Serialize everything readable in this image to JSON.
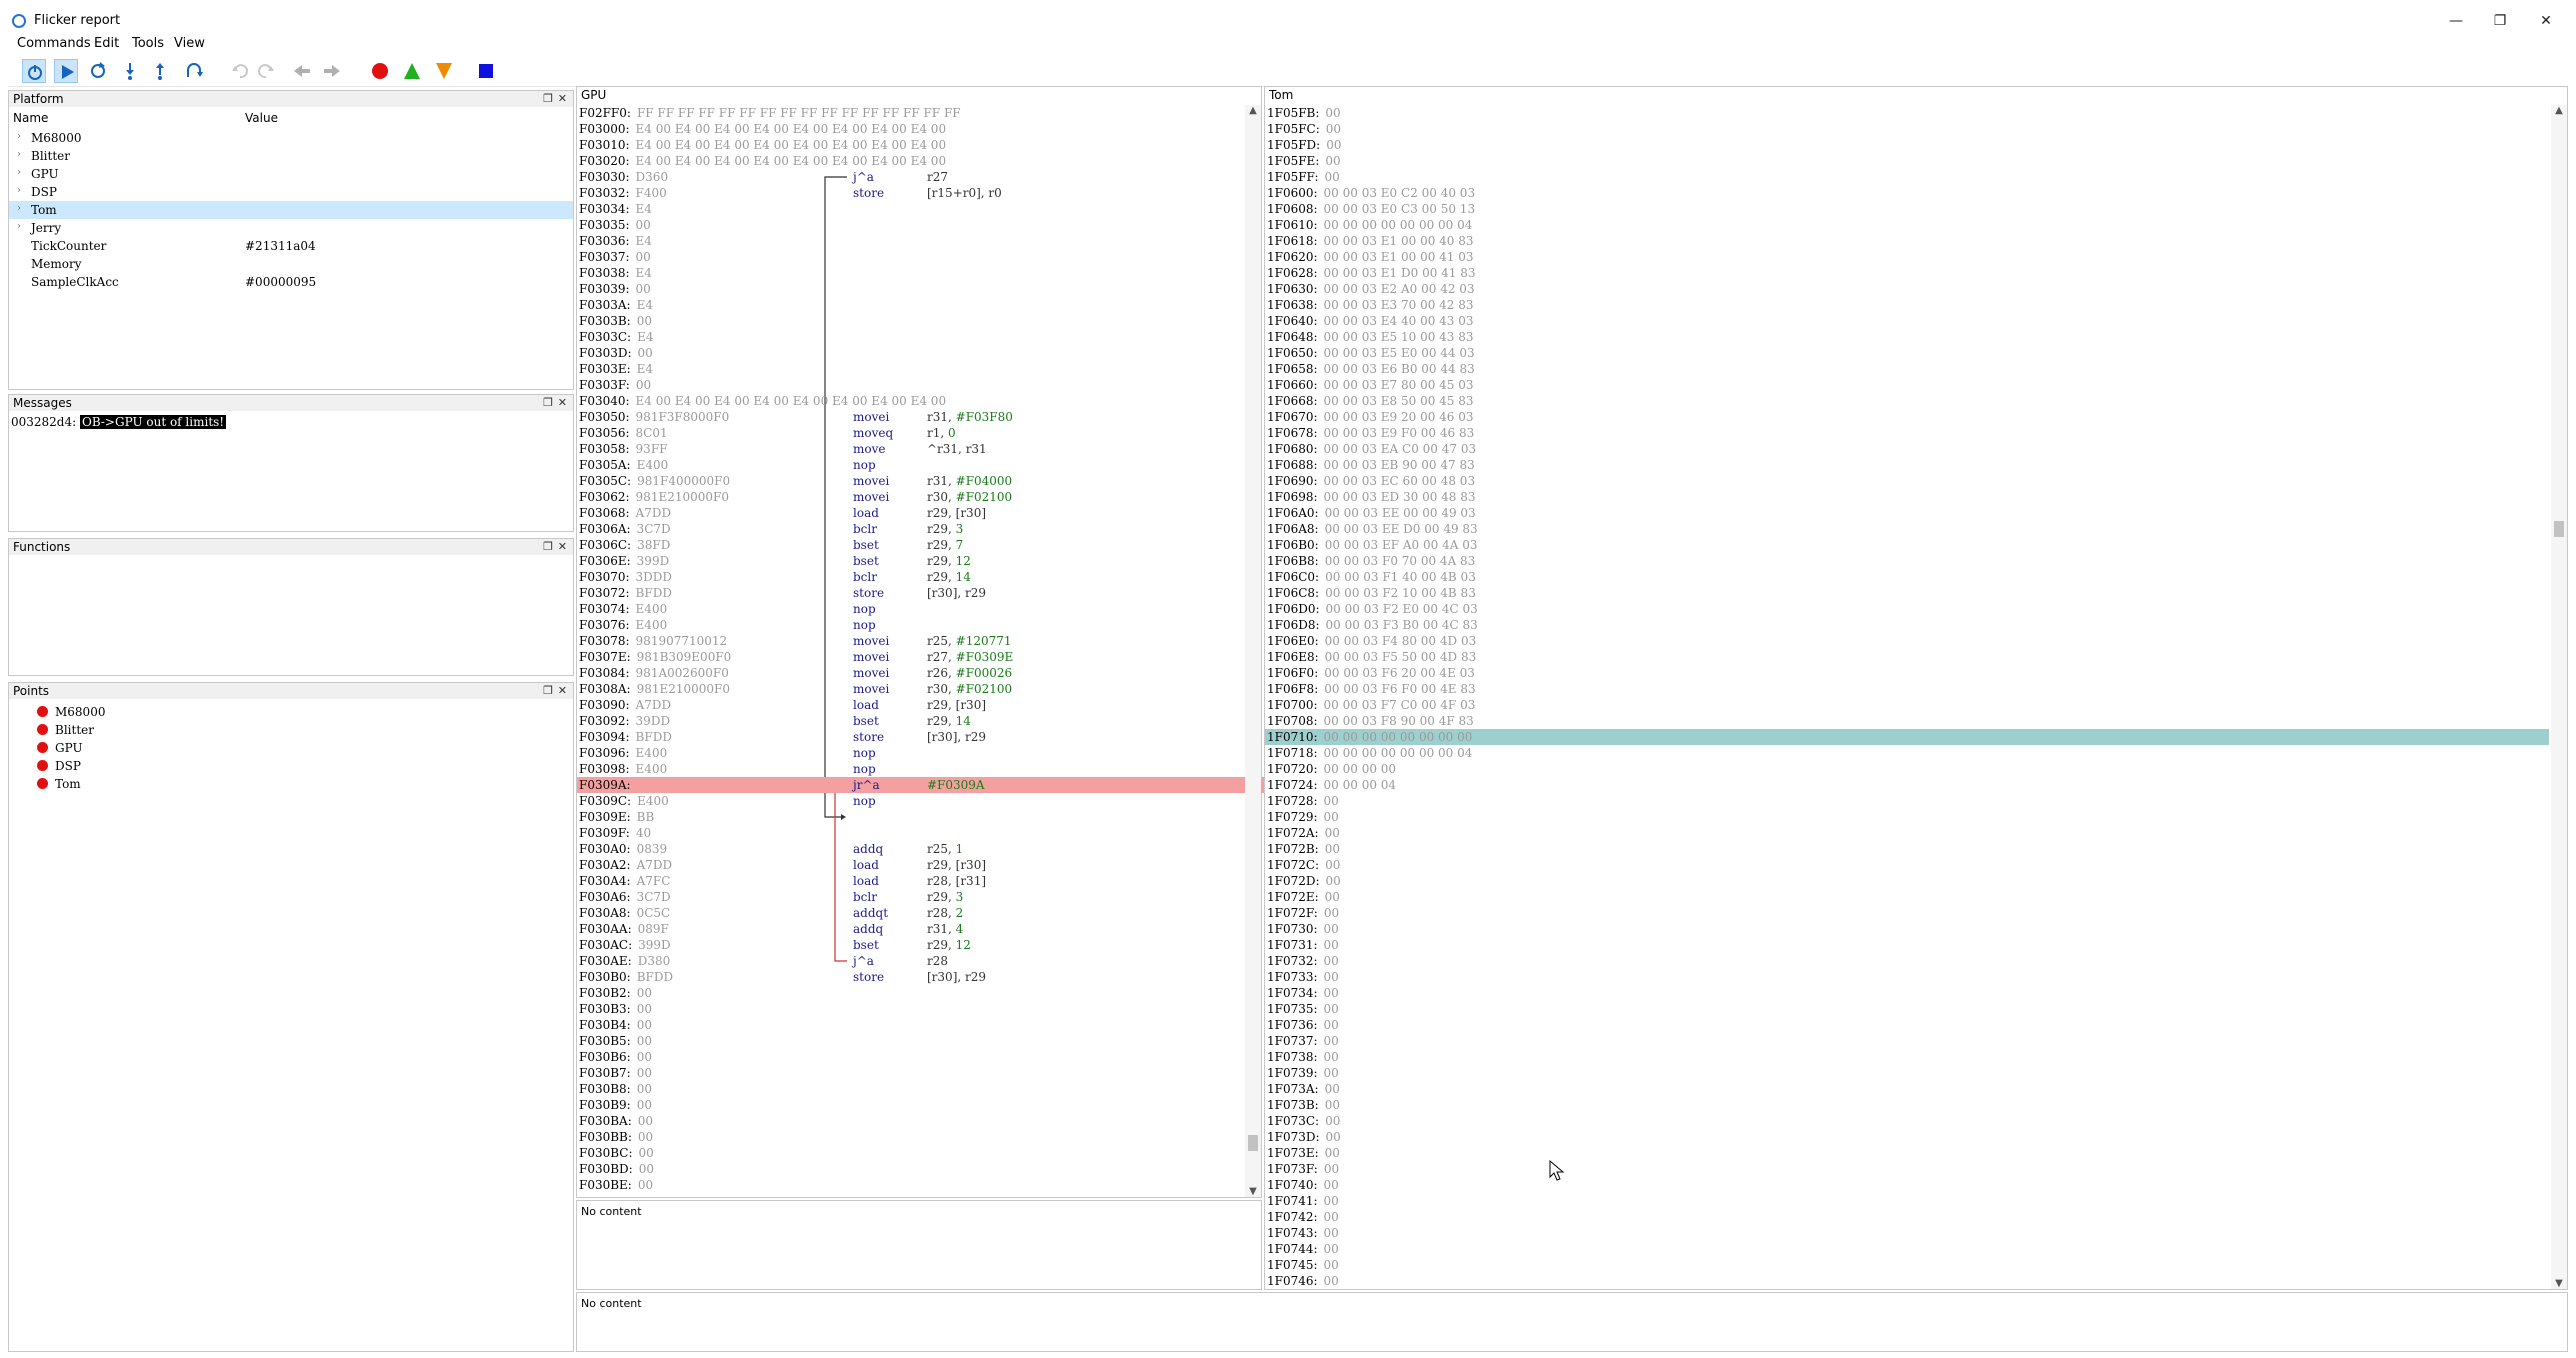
{
  "window": {
    "title": "Flicker report",
    "min": "—",
    "restore": "❐",
    "close": "✕"
  },
  "menu": [
    "Commands",
    "Edit",
    "Tools",
    "View"
  ],
  "panels": {
    "platform": {
      "title": "Platform",
      "col_name": "Name",
      "col_value": "Value",
      "rows": [
        {
          "name": "M68000",
          "value": "",
          "expander": true
        },
        {
          "name": "Blitter",
          "value": "",
          "expander": true
        },
        {
          "name": "GPU",
          "value": "",
          "expander": true
        },
        {
          "name": "DSP",
          "value": "",
          "expander": true
        },
        {
          "name": "Tom",
          "value": "",
          "expander": true,
          "selected": true
        },
        {
          "name": "Jerry",
          "value": "",
          "expander": true
        },
        {
          "name": "TickCounter",
          "value": "#21311a04",
          "expander": false
        },
        {
          "name": "Memory",
          "value": "",
          "expander": false
        },
        {
          "name": "SampleClkAcc",
          "value": "#00000095",
          "expander": false
        }
      ]
    },
    "messages": {
      "title": "Messages",
      "prefix": "003282d4:",
      "text": "OB->GPU out of limits!"
    },
    "functions": {
      "title": "Functions"
    },
    "points": {
      "title": "Points",
      "items": [
        "M68000",
        "Blitter",
        "GPU",
        "DSP",
        "Tom"
      ]
    },
    "gpu": {
      "title": "GPU",
      "status": "No content",
      "lines": [
        {
          "a": "F02FF0:",
          "b": "FF FF FF FF FF FF FF FF FF FF FF FF FF FF FF FF"
        },
        {
          "a": "F03000:",
          "b": "E4 00 E4 00 E4 00 E4 00 E4 00 E4 00 E4 00 E4 00"
        },
        {
          "a": "F03010:",
          "b": "E4 00 E4 00 E4 00 E4 00 E4 00 E4 00 E4 00 E4 00"
        },
        {
          "a": "F03020:",
          "b": "E4 00 E4 00 E4 00 E4 00 E4 00 E4 00 E4 00 E4 00"
        },
        {
          "a": "F03030:",
          "b": "D360",
          "m": "j^a",
          "o": "r27"
        },
        {
          "a": "F03032:",
          "b": "F400",
          "m": "store",
          "o": "[r15+r0], r0"
        },
        {
          "a": "F03034:",
          "b": "E4"
        },
        {
          "a": "F03035:",
          "b": "00"
        },
        {
          "a": "F03036:",
          "b": "E4"
        },
        {
          "a": "F03037:",
          "b": "00"
        },
        {
          "a": "F03038:",
          "b": "E4"
        },
        {
          "a": "F03039:",
          "b": "00"
        },
        {
          "a": "F0303A:",
          "b": "E4"
        },
        {
          "a": "F0303B:",
          "b": "00"
        },
        {
          "a": "F0303C:",
          "b": "E4"
        },
        {
          "a": "F0303D:",
          "b": "00"
        },
        {
          "a": "F0303E:",
          "b": "E4"
        },
        {
          "a": "F0303F:",
          "b": "00"
        },
        {
          "a": "F03040:",
          "b": "E4 00 E4 00 E4 00 E4 00 E4 00 E4 00 E4 00 E4 00"
        },
        {
          "a": "F03050:",
          "b": "981F3F8000F0",
          "m": "movei",
          "o": "r31, ",
          "i": "#F03F80"
        },
        {
          "a": "F03056:",
          "b": "8C01",
          "m": "moveq",
          "o": "r1, ",
          "i": "0"
        },
        {
          "a": "F03058:",
          "b": "93FF",
          "m": "move",
          "o": "^r31, r31"
        },
        {
          "a": "F0305A:",
          "b": "E400",
          "m": "nop"
        },
        {
          "a": "F0305C:",
          "b": "981F400000F0",
          "m": "movei",
          "o": "r31, ",
          "i": "#F04000"
        },
        {
          "a": "F03062:",
          "b": "981E210000F0",
          "m": "movei",
          "o": "r30, ",
          "i": "#F02100"
        },
        {
          "a": "F03068:",
          "b": "A7DD",
          "m": "load",
          "o": "r29, [r30]"
        },
        {
          "a": "F0306A:",
          "b": "3C7D",
          "m": "bclr",
          "o": "r29, ",
          "i": "3"
        },
        {
          "a": "F0306C:",
          "b": "38FD",
          "m": "bset",
          "o": "r29, ",
          "i": "7"
        },
        {
          "a": "F0306E:",
          "b": "399D",
          "m": "bset",
          "o": "r29, ",
          "i": "12"
        },
        {
          "a": "F03070:",
          "b": "3DDD",
          "m": "bclr",
          "o": "r29, ",
          "i": "14"
        },
        {
          "a": "F03072:",
          "b": "BFDD",
          "m": "store",
          "o": "[r30], r29"
        },
        {
          "a": "F03074:",
          "b": "E400",
          "m": "nop"
        },
        {
          "a": "F03076:",
          "b": "E400",
          "m": "nop"
        },
        {
          "a": "F03078:",
          "b": "981907710012",
          "m": "movei",
          "o": "r25, ",
          "i": "#120771"
        },
        {
          "a": "F0307E:",
          "b": "981B309E00F0",
          "m": "movei",
          "o": "r27, ",
          "i": "#F0309E"
        },
        {
          "a": "F03084:",
          "b": "981A002600F0",
          "m": "movei",
          "o": "r26, ",
          "i": "#F00026"
        },
        {
          "a": "F0308A:",
          "b": "981E210000F0",
          "m": "movei",
          "o": "r30, ",
          "i": "#F02100"
        },
        {
          "a": "F03090:",
          "b": "A7DD",
          "m": "load",
          "o": "r29, [r30]"
        },
        {
          "a": "F03092:",
          "b": "39DD",
          "m": "bset",
          "o": "r29, ",
          "i": "14"
        },
        {
          "a": "F03094:",
          "b": "BFDD",
          "m": "store",
          "o": "[r30], r29"
        },
        {
          "a": "F03096:",
          "b": "E400",
          "m": "nop"
        },
        {
          "a": "F03098:",
          "b": "E400",
          "m": "nop"
        },
        {
          "a": "F0309A:",
          "b": "",
          "m": "jr^a",
          "o": "",
          "i": "#F0309A",
          "hl": true
        },
        {
          "a": "F0309C:",
          "b": "E400",
          "m": "nop"
        },
        {
          "a": "F0309E:",
          "b": "BB"
        },
        {
          "a": "F0309F:",
          "b": "40"
        },
        {
          "a": "F030A0:",
          "b": "0839",
          "m": "addq",
          "o": "r25, ",
          "i": "1"
        },
        {
          "a": "F030A2:",
          "b": "A7DD",
          "m": "load",
          "o": "r29, [r30]"
        },
        {
          "a": "F030A4:",
          "b": "A7FC",
          "m": "load",
          "o": "r28, [r31]"
        },
        {
          "a": "F030A6:",
          "b": "3C7D",
          "m": "bclr",
          "o": "r29, ",
          "i": "3"
        },
        {
          "a": "F030A8:",
          "b": "0C5C",
          "m": "addqt",
          "o": "r28, ",
          "i": "2"
        },
        {
          "a": "F030AA:",
          "b": "089F",
          "m": "addq",
          "o": "r31, ",
          "i": "4"
        },
        {
          "a": "F030AC:",
          "b": "399D",
          "m": "bset",
          "o": "r29, ",
          "i": "12"
        },
        {
          "a": "F030AE:",
          "b": "D380",
          "m": "j^a",
          "o": "r28"
        },
        {
          "a": "F030B0:",
          "b": "BFDD",
          "m": "store",
          "o": "[r30], r29"
        },
        {
          "a": "F030B2:",
          "b": "00"
        },
        {
          "a": "F030B3:",
          "b": "00"
        },
        {
          "a": "F030B4:",
          "b": "00"
        },
        {
          "a": "F030B5:",
          "b": "00"
        },
        {
          "a": "F030B6:",
          "b": "00"
        },
        {
          "a": "F030B7:",
          "b": "00"
        },
        {
          "a": "F030B8:",
          "b": "00"
        },
        {
          "a": "F030B9:",
          "b": "00"
        },
        {
          "a": "F030BA:",
          "b": "00"
        },
        {
          "a": "F030BB:",
          "b": "00"
        },
        {
          "a": "F030BC:",
          "b": "00"
        },
        {
          "a": "F030BD:",
          "b": "00"
        },
        {
          "a": "F030BE:",
          "b": "00"
        }
      ]
    },
    "tom": {
      "title": "Tom",
      "lines": [
        {
          "a": "1F05FB:",
          "b": "00"
        },
        {
          "a": "1F05FC:",
          "b": "00"
        },
        {
          "a": "1F05FD:",
          "b": "00"
        },
        {
          "a": "1F05FE:",
          "b": "00"
        },
        {
          "a": "1F05FF:",
          "b": "00"
        },
        {
          "a": "1F0600:",
          "b": "00 00 03 E0 C2 00 40 03"
        },
        {
          "a": "1F0608:",
          "b": "00 00 03 E0 C3 00 50 13"
        },
        {
          "a": "1F0610:",
          "b": "00 00 00 00 00 00 00 04"
        },
        {
          "a": "1F0618:",
          "b": "00 00 03 E1 00 00 40 83"
        },
        {
          "a": "1F0620:",
          "b": "00 00 03 E1 00 00 41 03"
        },
        {
          "a": "1F0628:",
          "b": "00 00 03 E1 D0 00 41 83"
        },
        {
          "a": "1F0630:",
          "b": "00 00 03 E2 A0 00 42 03"
        },
        {
          "a": "1F0638:",
          "b": "00 00 03 E3 70 00 42 83"
        },
        {
          "a": "1F0640:",
          "b": "00 00 03 E4 40 00 43 03"
        },
        {
          "a": "1F0648:",
          "b": "00 00 03 E5 10 00 43 83"
        },
        {
          "a": "1F0650:",
          "b": "00 00 03 E5 E0 00 44 03"
        },
        {
          "a": "1F0658:",
          "b": "00 00 03 E6 B0 00 44 83"
        },
        {
          "a": "1F0660:",
          "b": "00 00 03 E7 80 00 45 03"
        },
        {
          "a": "1F0668:",
          "b": "00 00 03 E8 50 00 45 83"
        },
        {
          "a": "1F0670:",
          "b": "00 00 03 E9 20 00 46 03"
        },
        {
          "a": "1F0678:",
          "b": "00 00 03 E9 F0 00 46 83"
        },
        {
          "a": "1F0680:",
          "b": "00 00 03 EA C0 00 47 03"
        },
        {
          "a": "1F0688:",
          "b": "00 00 03 EB 90 00 47 83"
        },
        {
          "a": "1F0690:",
          "b": "00 00 03 EC 60 00 48 03"
        },
        {
          "a": "1F0698:",
          "b": "00 00 03 ED 30 00 48 83"
        },
        {
          "a": "1F06A0:",
          "b": "00 00 03 EE 00 00 49 03"
        },
        {
          "a": "1F06A8:",
          "b": "00 00 03 EE D0 00 49 83"
        },
        {
          "a": "1F06B0:",
          "b": "00 00 03 EF A0 00 4A 03"
        },
        {
          "a": "1F06B8:",
          "b": "00 00 03 F0 70 00 4A 83"
        },
        {
          "a": "1F06C0:",
          "b": "00 00 03 F1 40 00 4B 03"
        },
        {
          "a": "1F06C8:",
          "b": "00 00 03 F2 10 00 4B 83"
        },
        {
          "a": "1F06D0:",
          "b": "00 00 03 F2 E0 00 4C 03"
        },
        {
          "a": "1F06D8:",
          "b": "00 00 03 F3 B0 00 4C 83"
        },
        {
          "a": "1F06E0:",
          "b": "00 00 03 F4 80 00 4D 03"
        },
        {
          "a": "1F06E8:",
          "b": "00 00 03 F5 50 00 4D 83"
        },
        {
          "a": "1F06F0:",
          "b": "00 00 03 F6 20 00 4E 03"
        },
        {
          "a": "1F06F8:",
          "b": "00 00 03 F6 F0 00 4E 83"
        },
        {
          "a": "1F0700:",
          "b": "00 00 03 F7 C0 00 4F 03"
        },
        {
          "a": "1F0708:",
          "b": "00 00 03 F8 90 00 4F 83"
        },
        {
          "a": "1F0710:",
          "b": "00 00 00 00 00 00 00 00",
          "hl": true
        },
        {
          "a": "1F0718:",
          "b": "00 00 00 00 00 00 00 04"
        },
        {
          "a": "1F0720:",
          "b": "00 00 00 00"
        },
        {
          "a": "1F0724:",
          "b": "00 00 00 04"
        },
        {
          "a": "1F0728:",
          "b": "00"
        },
        {
          "a": "1F0729:",
          "b": "00"
        },
        {
          "a": "1F072A:",
          "b": "00"
        },
        {
          "a": "1F072B:",
          "b": "00"
        },
        {
          "a": "1F072C:",
          "b": "00"
        },
        {
          "a": "1F072D:",
          "b": "00"
        },
        {
          "a": "1F072E:",
          "b": "00"
        },
        {
          "a": "1F072F:",
          "b": "00"
        },
        {
          "a": "1F0730:",
          "b": "00"
        },
        {
          "a": "1F0731:",
          "b": "00"
        },
        {
          "a": "1F0732:",
          "b": "00"
        },
        {
          "a": "1F0733:",
          "b": "00"
        },
        {
          "a": "1F0734:",
          "b": "00"
        },
        {
          "a": "1F0735:",
          "b": "00"
        },
        {
          "a": "1F0736:",
          "b": "00"
        },
        {
          "a": "1F0737:",
          "b": "00"
        },
        {
          "a": "1F0738:",
          "b": "00"
        },
        {
          "a": "1F0739:",
          "b": "00"
        },
        {
          "a": "1F073A:",
          "b": "00"
        },
        {
          "a": "1F073B:",
          "b": "00"
        },
        {
          "a": "1F073C:",
          "b": "00"
        },
        {
          "a": "1F073D:",
          "b": "00"
        },
        {
          "a": "1F073E:",
          "b": "00"
        },
        {
          "a": "1F073F:",
          "b": "00"
        },
        {
          "a": "1F0740:",
          "b": "00"
        },
        {
          "a": "1F0741:",
          "b": "00"
        },
        {
          "a": "1F0742:",
          "b": "00"
        },
        {
          "a": "1F0743:",
          "b": "00"
        },
        {
          "a": "1F0744:",
          "b": "00"
        },
        {
          "a": "1F0745:",
          "b": "00"
        },
        {
          "a": "1F0746:",
          "b": "00"
        }
      ]
    },
    "bottom": {
      "status": "No content"
    }
  },
  "colors": {
    "breakpoint": "#e01010",
    "highlight_row": "#f4a0a0",
    "selected_row": "#9ecfcf",
    "mnemonic": "#1a1a8c",
    "immediate": "#1a7a1a"
  }
}
